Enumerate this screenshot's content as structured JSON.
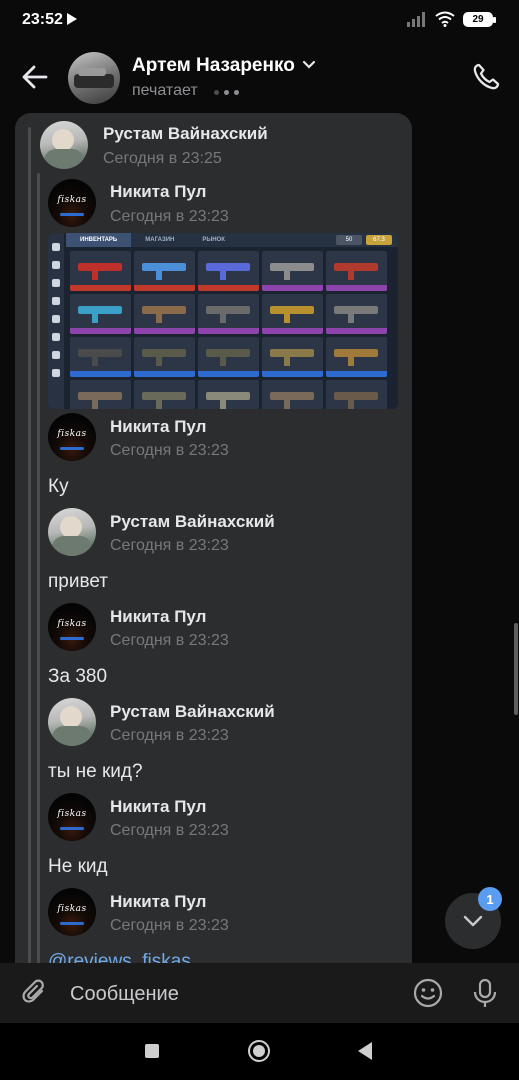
{
  "status_bar": {
    "time": "23:52",
    "battery": "29"
  },
  "header": {
    "name": "Артем Назаренко",
    "status": "печатает"
  },
  "messages": [
    {
      "author": "Рустам Вайнахский",
      "time": "Сегодня в 23:25",
      "avatar": "rustam"
    },
    {
      "author": "Никита Пул",
      "time": "Сегодня в 23:23",
      "avatar": "nikita",
      "attachment": "game-inventory-screenshot"
    },
    {
      "author": "Никита Пул",
      "time": "Сегодня в 23:23",
      "text": "Ку"
    },
    {
      "author": "Рустам Вайнахский",
      "time": "Сегодня в 23:23",
      "text": "привет"
    },
    {
      "author": "Никита Пул",
      "time": "Сегодня в 23:23",
      "text": "За 380"
    },
    {
      "author": "Рустам Вайнахский",
      "time": "Сегодня в 23:23",
      "text": "ты не кид?"
    },
    {
      "author": "Никита Пул",
      "time": "Сегодня в 23:23",
      "text": "Не кид"
    },
    {
      "author": "Никита Пул",
      "time": "Сегодня в 23:23",
      "link": "@reviews_fiskas"
    }
  ],
  "avatar_logo": "fiskas",
  "attachment": {
    "tabs": [
      "ИНВЕНТАРЬ",
      "МАГАЗИН",
      "РЫНОК"
    ],
    "currency": [
      "50",
      "67.3"
    ]
  },
  "scroll_button": {
    "badge": "1"
  },
  "composer": {
    "placeholder": "Сообщение"
  },
  "icons": {
    "back": "arrow-left-icon",
    "chevron": "chevron-down-icon",
    "call": "phone-icon",
    "attach": "paperclip-icon",
    "emoji": "smile-icon",
    "mic": "microphone-icon",
    "scroll": "chevron-down-icon"
  },
  "colors": {
    "background": "#0a0a0a",
    "bubble": "#2c2d2e",
    "link": "#71aaeb",
    "badge": "#5a9cf0",
    "muted": "#76787a"
  }
}
